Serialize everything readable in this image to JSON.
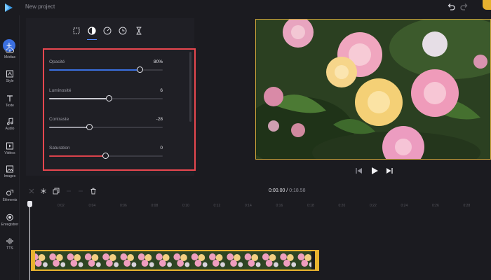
{
  "app": {
    "project_name": "New project"
  },
  "rail": {
    "add_label": "+",
    "items": [
      {
        "label": "Médias",
        "icon": "cloud-upload-icon"
      },
      {
        "label": "Style",
        "icon": "text-style-icon"
      },
      {
        "label": "Texte",
        "icon": "text-icon"
      },
      {
        "label": "Audio",
        "icon": "music-icon"
      },
      {
        "label": "Vidéos",
        "icon": "video-icon"
      },
      {
        "label": "Images",
        "icon": "image-icon"
      },
      {
        "label": "Éléments",
        "icon": "shapes-icon"
      },
      {
        "label": "Enregistrer",
        "icon": "record-icon"
      },
      {
        "label": "TTS",
        "icon": "audio-wave-icon"
      }
    ]
  },
  "properties": {
    "tabs": [
      "crop-icon",
      "contrast-icon",
      "speed-icon",
      "clock-icon",
      "hourglass-icon"
    ],
    "active_tab": 1,
    "sliders": [
      {
        "label": "Opacité",
        "value": "80%",
        "level": 0.8,
        "color": "#3b6fe0"
      },
      {
        "label": "Luminosité",
        "value": "6",
        "level": 0.53,
        "color": "#c9c9d0"
      },
      {
        "label": "Contraste",
        "value": "-28",
        "level": 0.36,
        "color": "#9a9aa3"
      },
      {
        "label": "Saturation",
        "value": "0",
        "level": 0.5,
        "color": "#d9424b"
      }
    ]
  },
  "transport": [
    "skip-back-icon",
    "play-icon",
    "skip-forward-icon"
  ],
  "timeline": {
    "current_time": "0:00.00",
    "separator": " / ",
    "duration": "0:18.58",
    "toolbar_icons": [
      "split-icon",
      "freeze-icon",
      "duplicate-icon",
      "undo-icon",
      "redo-icon",
      "delete-icon"
    ],
    "ticks": [
      "0:02",
      "0:04",
      "0:06",
      "0:08",
      "0:10",
      "0:12",
      "0:14",
      "0:16",
      "0:18",
      "0:20",
      "0:22",
      "0:24",
      "0:26",
      "0:28"
    ]
  },
  "colors": {
    "accent": "#3b6fe0",
    "clip_border": "#e8b22f",
    "highlight": "#e8474f"
  }
}
